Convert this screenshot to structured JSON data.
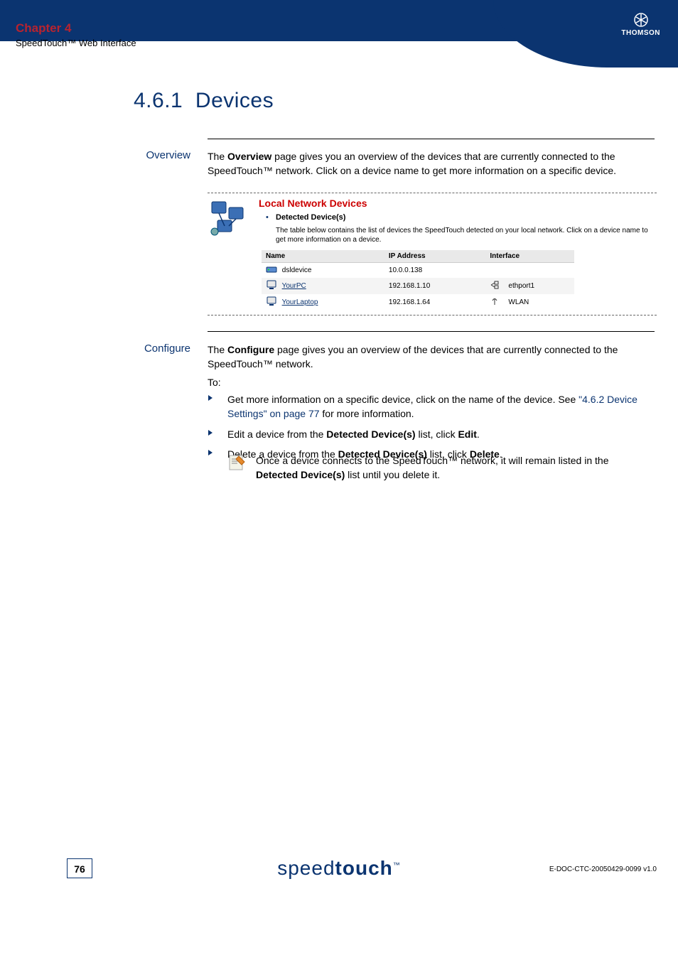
{
  "header": {
    "chapter": "Chapter 4",
    "subtitle": "SpeedTouch™ Web Interface",
    "brand": "THOMSON"
  },
  "title_num": "4.6.1",
  "title_text": "Devices",
  "overview": {
    "label": "Overview",
    "para_pre": "The ",
    "para_bold": "Overview",
    "para_post": " page gives you an overview of the devices that are currently connected to the SpeedTouch™ network. Click on a device name to get more information on a specific device."
  },
  "screenshot": {
    "heading": "Local Network Devices",
    "sub": "Detected Device(s)",
    "desc": "The table below contains the list of devices the SpeedTouch detected on your local network. Click on a device name to get more information on a device.",
    "cols": {
      "c1": "Name",
      "c2": "IP Address",
      "c3": "Interface"
    },
    "rows": [
      {
        "name": "dsldevice",
        "ip": "10.0.0.138",
        "iface": "",
        "link": false,
        "icon": "router"
      },
      {
        "name": "YourPC",
        "ip": "192.168.1.10",
        "iface": "ethport1",
        "link": true,
        "icon": "pc"
      },
      {
        "name": "YourLaptop",
        "ip": "192.168.1.64",
        "iface": "WLAN",
        "link": true,
        "icon": "pc"
      }
    ]
  },
  "configure": {
    "label": "Configure",
    "para_pre": "The ",
    "para_bold": "Configure",
    "para_post": " page gives you an overview of the devices that are currently connected to the SpeedTouch™ network.",
    "to": "To:",
    "bullets": [
      {
        "pre": "Get more information on a specific device, click on the name of the device. See ",
        "link": "\"4.6.2 Device Settings\" on page 77",
        "post": " for more information."
      },
      {
        "pre": "Edit a device from the ",
        "bold": "Detected Device(s)",
        "post": " list, click ",
        "bold2": "Edit",
        "post2": "."
      },
      {
        "pre": "Delete a device from the ",
        "bold": "Detected Device(s)",
        "post": " list, click ",
        "bold2": "Delete",
        "post2": "."
      }
    ],
    "tip_pre": "Once a device connects to the SpeedTouch™ network, it will remain listed in the ",
    "tip_bold": "Detected Device(s)",
    "tip_post": " list until you delete it."
  },
  "footer": {
    "page": "76",
    "brand_light": "speed",
    "brand_bold": "touch",
    "docid": "E-DOC-CTC-20050429-0099 v1.0"
  }
}
